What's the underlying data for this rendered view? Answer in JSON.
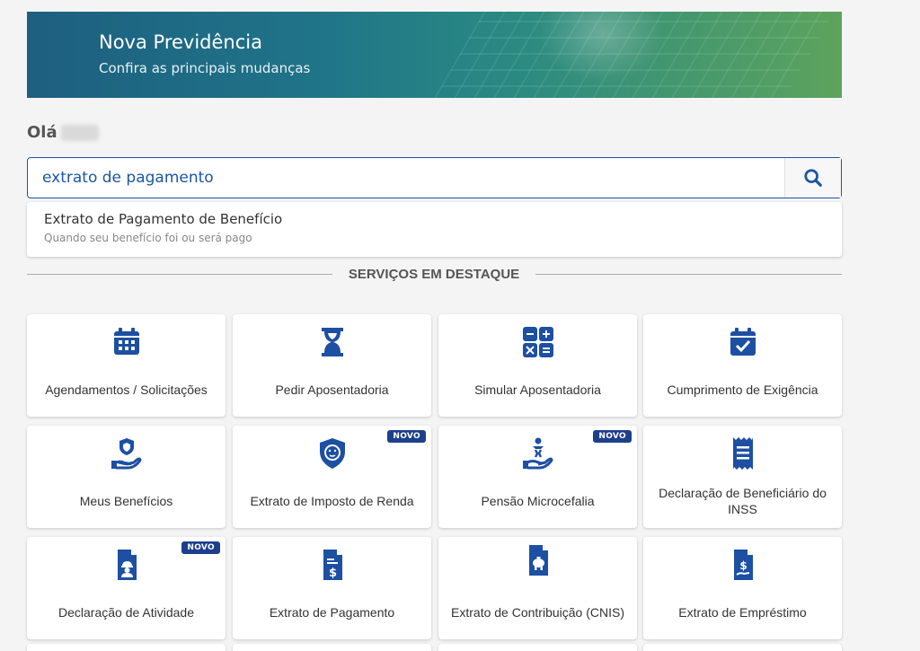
{
  "banner": {
    "title": "Nova Previdência",
    "subtitle": "Confira as principais mudanças"
  },
  "greeting": "Olá",
  "search": {
    "value": "extrato de pagamento",
    "placeholder": ""
  },
  "suggestion": {
    "title": "Extrato de Pagamento de Benefício",
    "subtitle": "Quando seu benefício foi ou será pago"
  },
  "section_title": "SERVIÇOS EM DESTAQUE",
  "badge_text": "NOVO",
  "cards": [
    {
      "label": "Agendamentos / Solicitações",
      "icon": "calendar-icon"
    },
    {
      "label": "Pedir Aposentadoria",
      "icon": "hourglass-icon"
    },
    {
      "label": "Simular Aposentadoria",
      "icon": "calculator-icon"
    },
    {
      "label": "Cumprimento de Exigência",
      "icon": "calendar-check-icon"
    },
    {
      "label": "Meus Benefícios",
      "icon": "hand-shield-icon"
    },
    {
      "label": "Extrato de Imposto de Renda",
      "icon": "lion-shield-icon"
    },
    {
      "label": "Pensão Microcefalia",
      "icon": "hand-child-icon"
    },
    {
      "label": "Declaração de Beneficiário do INSS",
      "icon": "receipt-icon"
    },
    {
      "label": "Declaração de Atividade",
      "icon": "document-worker-icon"
    },
    {
      "label": "Extrato de Pagamento",
      "icon": "document-dollar-icon"
    },
    {
      "label": "Extrato de Contribuição (CNIS)",
      "icon": "document-piggybank-icon"
    },
    {
      "label": "Extrato de Empréstimo",
      "icon": "document-hand-dollar-icon"
    }
  ],
  "colors": {
    "primary": "#1b56a3",
    "icon": "#1d4fa3",
    "badge": "#1d3f8c"
  }
}
